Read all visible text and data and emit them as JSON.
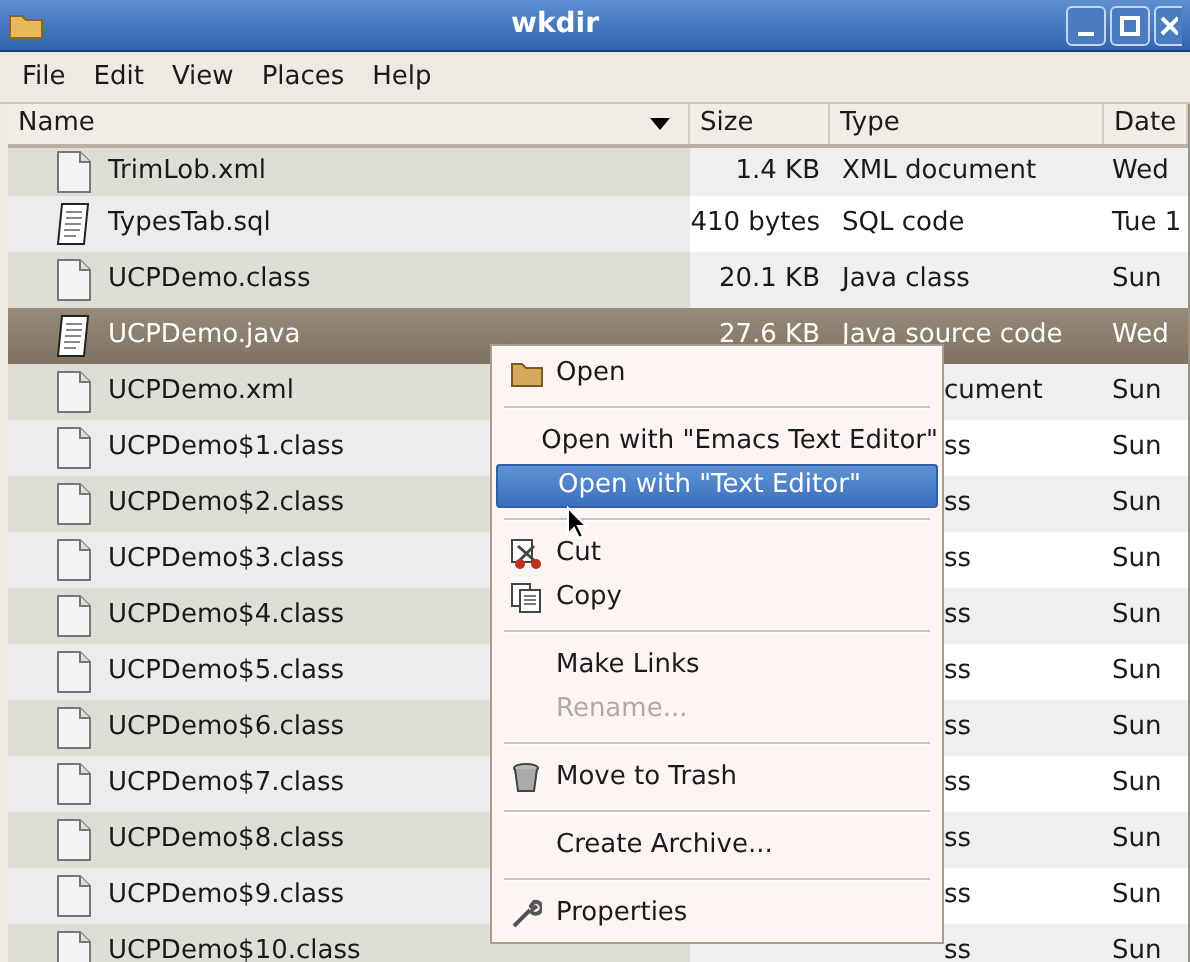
{
  "window": {
    "title": "wkdir"
  },
  "menubar": [
    "File",
    "Edit",
    "View",
    "Places",
    "Help"
  ],
  "columns": [
    "Name",
    "Size",
    "Type",
    "Date"
  ],
  "rows": [
    {
      "name": "TrimLob.xml",
      "kind": "blank",
      "size": "1.4 KB",
      "type": "XML document",
      "date": "Wed",
      "selected": false
    },
    {
      "name": "TypesTab.sql",
      "kind": "text",
      "size": "410 bytes",
      "type": "SQL code",
      "date": "Tue 1",
      "selected": false
    },
    {
      "name": "UCPDemo.class",
      "kind": "blank",
      "size": "20.1 KB",
      "type": "Java class",
      "date": "Sun",
      "selected": false
    },
    {
      "name": "UCPDemo.java",
      "kind": "text",
      "size": "27.6 KB",
      "type": "Java source code",
      "date": "Wed",
      "selected": true
    },
    {
      "name": "UCPDemo.xml",
      "kind": "blank",
      "type": "cument",
      "date": "Sun",
      "selected": false
    },
    {
      "name": "UCPDemo$1.class",
      "kind": "blank",
      "type": "ss",
      "date": "Sun",
      "selected": false
    },
    {
      "name": "UCPDemo$2.class",
      "kind": "blank",
      "type": "ss",
      "date": "Sun",
      "selected": false
    },
    {
      "name": "UCPDemo$3.class",
      "kind": "blank",
      "type": "ss",
      "date": "Sun",
      "selected": false
    },
    {
      "name": "UCPDemo$4.class",
      "kind": "blank",
      "type": "ss",
      "date": "Sun",
      "selected": false
    },
    {
      "name": "UCPDemo$5.class",
      "kind": "blank",
      "type": "ss",
      "date": "Sun",
      "selected": false
    },
    {
      "name": "UCPDemo$6.class",
      "kind": "blank",
      "type": "ss",
      "date": "Sun",
      "selected": false
    },
    {
      "name": "UCPDemo$7.class",
      "kind": "blank",
      "type": "ss",
      "date": "Sun",
      "selected": false
    },
    {
      "name": "UCPDemo$8.class",
      "kind": "blank",
      "type": "ss",
      "date": "Sun",
      "selected": false
    },
    {
      "name": "UCPDemo$9.class",
      "kind": "blank",
      "type": "ss",
      "date": "Sun",
      "selected": false
    },
    {
      "name": "UCPDemo$10.class",
      "kind": "blank",
      "type": "ss",
      "date": "Sun",
      "selected": false
    }
  ],
  "context_menu": [
    {
      "kind": "folder",
      "label": "Open",
      "selected": false,
      "disabled": false
    },
    {
      "kind": "separator"
    },
    {
      "kind": "plain",
      "label": "Open with \"Emacs Text Editor\"",
      "selected": false,
      "disabled": false
    },
    {
      "kind": "plain",
      "label": "Open with \"Text Editor\"",
      "selected": true,
      "disabled": false
    },
    {
      "kind": "separator"
    },
    {
      "kind": "scissors",
      "label": "Cut",
      "selected": false,
      "disabled": false
    },
    {
      "kind": "copy",
      "label": "Copy",
      "selected": false,
      "disabled": false
    },
    {
      "kind": "separator"
    },
    {
      "kind": "plain",
      "label": "Make Links",
      "selected": false,
      "disabled": false
    },
    {
      "kind": "plain",
      "label": "Rename...",
      "selected": false,
      "disabled": true
    },
    {
      "kind": "separator"
    },
    {
      "kind": "trash",
      "label": "Move to Trash",
      "selected": false,
      "disabled": false
    },
    {
      "kind": "separator"
    },
    {
      "kind": "plain",
      "label": "Create Archive...",
      "selected": false,
      "disabled": false
    },
    {
      "kind": "separator"
    },
    {
      "kind": "wrench",
      "label": "Properties",
      "selected": false,
      "disabled": false
    }
  ]
}
